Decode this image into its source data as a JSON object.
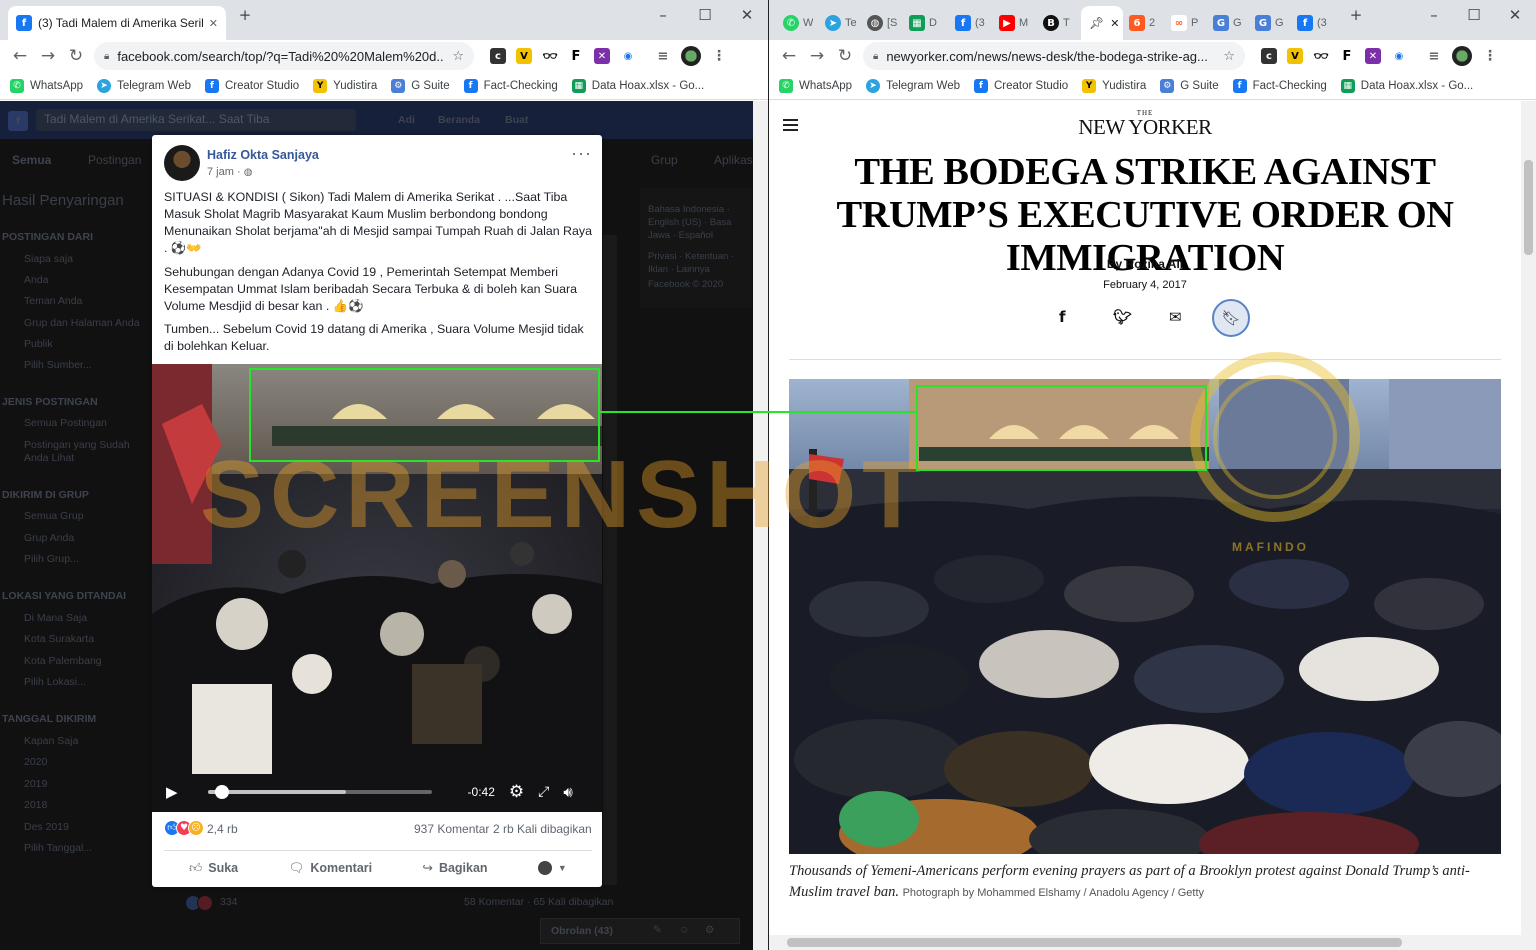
{
  "left_window": {
    "tab_title": "(3) Tadi Malem di Amerika Serikat",
    "url": "facebook.com/search/top/?q=Tadi%20%20Malem%20d...",
    "bookmarks": [
      "WhatsApp",
      "Telegram Web",
      "Creator Studio",
      "Yudistira",
      "G Suite",
      "Fact-Checking",
      "Data Hoax.xlsx - Go..."
    ],
    "fb_search": "Tadi Malem di Amerika Serikat... Saat Tiba",
    "fb_nav": [
      "Adi",
      "Beranda",
      "Buat"
    ],
    "fb_tabs": [
      "Semua",
      "Postingan",
      "Grup",
      "Aplikasi"
    ],
    "sidebar": {
      "heading": "Hasil Penyaringan",
      "groups": [
        {
          "title": "POSTINGAN DARI",
          "items": [
            "Siapa saja",
            "Anda",
            "Teman Anda",
            "Grup dan Halaman Anda",
            "Publik",
            "Pilih Sumber..."
          ]
        },
        {
          "title": "JENIS POSTINGAN",
          "items": [
            "Semua Postingan",
            "Postingan yang Sudah Anda Lihat"
          ]
        },
        {
          "title": "DIKIRIM DI GRUP",
          "items": [
            "Semua Grup",
            "Grup Anda",
            "Pilih Grup..."
          ]
        },
        {
          "title": "LOKASI YANG DITANDAI",
          "items": [
            "Di Mana Saja",
            "Kota Surakarta",
            "Kota Palembang",
            "Pilih Lokasi..."
          ]
        },
        {
          "title": "TANGGAL DIKIRIM",
          "items": [
            "Kapan Saja",
            "2020",
            "2019",
            "2018",
            "Des 2019",
            "Pilih Tanggal..."
          ]
        }
      ]
    },
    "right_col_text": [
      "Bahasa Indonesia · English (US) · Basa Jawa · Español",
      "Privasi · Ketentuan · Iklan · Lainnya",
      "Facebook © 2020"
    ],
    "chat_label": "Obrolan (43)",
    "bg_post_stats": {
      "reactions": "334",
      "comments": "58 Komentar · 65 Kali dibagikan"
    },
    "post": {
      "author": "Hafiz Okta Sanjaya",
      "time": "7 jam",
      "more": "···",
      "paragraphs": [
        "SITUASI & KONDISI ( Sikon) Tadi Malem di Amerika Serikat . ...Saat Tiba Masuk Sholat Magrib Masyarakat Kaum Muslim berbondong bondong Menunaikan Sholat berjama\"ah di Mesjid sampai Tumpah Ruah di Jalan Raya . ⚽👐",
        "Sehubungan dengan Adanya Covid 19 , Pemerintah Setempat Memberi Kesempatan Ummat Islam beribadah Secara Terbuka & di boleh kan Suara Volume Mesdjid di besar kan . 👍⚽",
        "Tumben... Sebelum Covid 19 datang di Amerika , Suara Volume Mesjid tidak di bolehkan Keluar."
      ],
      "video": {
        "time_remaining": "-0:42",
        "progress": 0.03,
        "buffered": 0.62
      },
      "reaction_count": "2,4 rb",
      "comments": "937 Komentar",
      "shares": "2 rb Kali dibagikan",
      "actions": {
        "like": "Suka",
        "comment": "Komentari",
        "share": "Bagikan"
      }
    }
  },
  "right_window": {
    "tabs": [
      "W",
      "Te",
      "[S",
      "D",
      "(3",
      "M",
      "T",
      "2",
      "P",
      "G",
      "G",
      "(3"
    ],
    "active_tab_label": "",
    "url": "newyorker.com/news/news-desk/the-bodega-strike-ag...",
    "bookmarks": [
      "WhatsApp",
      "Telegram Web",
      "Creator Studio",
      "Yudistira",
      "G Suite",
      "Fact-Checking",
      "Data Hoax.xlsx - Go..."
    ],
    "article": {
      "logo_the": "THE",
      "logo": "NEW YORKER",
      "title": "The Bodega Strike Against Trump’s Executive Order on Immigration",
      "byline": "By Rozina Ali",
      "date": "February 4, 2017",
      "caption": "Thousands of Yemeni-Americans perform evening prayers as part of a Brooklyn protest against Donald Trump’s anti-Muslim travel ban.",
      "credit": "Photograph by Mohammed Elshamy / Anadolu Agency / Getty"
    }
  },
  "watermark": "SCREENSHOT",
  "seal_text": "MAFINDO",
  "colors": {
    "highlight": "#2be22b",
    "watermark": "#e7a028",
    "fb_blue": "#385898"
  }
}
